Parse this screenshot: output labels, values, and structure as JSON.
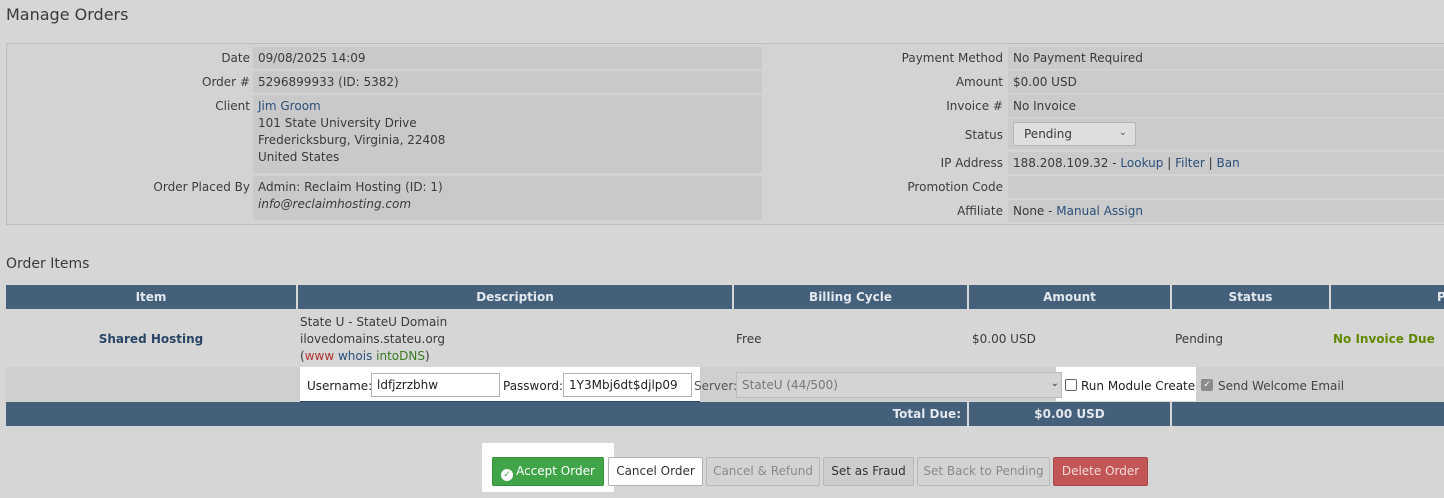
{
  "page_title": "Manage Orders",
  "details": {
    "date_label": "Date",
    "date_value": "09/08/2025 14:09",
    "order_label": "Order #",
    "order_value": "5296899933 (ID: 5382)",
    "client_label": "Client",
    "client_name": "Jim Groom",
    "client_address1": "101 State University Drive",
    "client_address2": "Fredericksburg, Virginia, 22408",
    "client_country": "United States",
    "placed_by_label": "Order Placed By",
    "placed_by_value": "Admin: Reclaim Hosting (ID: 1)",
    "placed_by_email": "info@reclaimhosting.com",
    "payment_method_label": "Payment Method",
    "payment_method_value": "No Payment Required",
    "amount_label": "Amount",
    "amount_value": "$0.00 USD",
    "invoice_label": "Invoice #",
    "invoice_value": "No Invoice",
    "status_label": "Status",
    "status_value": "Pending",
    "ip_label": "IP Address",
    "ip_value": "188.208.109.32 -",
    "ip_lookup": "Lookup",
    "ip_filter": "Filter",
    "ip_ban": "Ban",
    "ip_sep": "|",
    "promo_label": "Promotion Code",
    "affiliate_label": "Affiliate",
    "affiliate_value": "None -",
    "affiliate_link": "Manual Assign"
  },
  "order_items": {
    "title": "Order Items",
    "columns": [
      "Item",
      "Description",
      "Billing Cycle",
      "Amount",
      "Status",
      "P"
    ],
    "row": {
      "item": "Shared Hosting",
      "desc_line1": "State U - StateU Domain",
      "desc_line2": "ilovedomains.stateu.org",
      "desc_open": "(",
      "desc_www": "www",
      "desc_whois": "whois",
      "desc_intodns": "intoDNS",
      "desc_close": ")",
      "billing_cycle": "Free",
      "amount": "$0.00 USD",
      "status": "Pending",
      "payment": "No Invoice Due"
    },
    "provision": {
      "username_label": "Username:",
      "username_value": "ldfjzrzbhw",
      "password_label": "Password:",
      "password_value": "1Y3Mbj6dt$djlp09",
      "server_label": "Server:",
      "server_value": "StateU (44/500)",
      "run_module_label": "Run Module Create",
      "send_welcome_label": "Send Welcome Email"
    },
    "total_label": "Total Due:",
    "total_value": "$0.00 USD"
  },
  "buttons": {
    "accept": "Accept Order",
    "cancel": "Cancel Order",
    "cancel_refund": "Cancel & Refund",
    "fraud": "Set as Fraud",
    "back_pending": "Set Back to Pending",
    "delete": "Delete Order"
  },
  "colors": {
    "header_bg": "#45607a",
    "accept_green": "#3fa548",
    "delete_red": "#c25555",
    "no_invoice_green": "#5f8a00",
    "www_red": "#b03030",
    "intodns_green": "#3a7a20"
  }
}
